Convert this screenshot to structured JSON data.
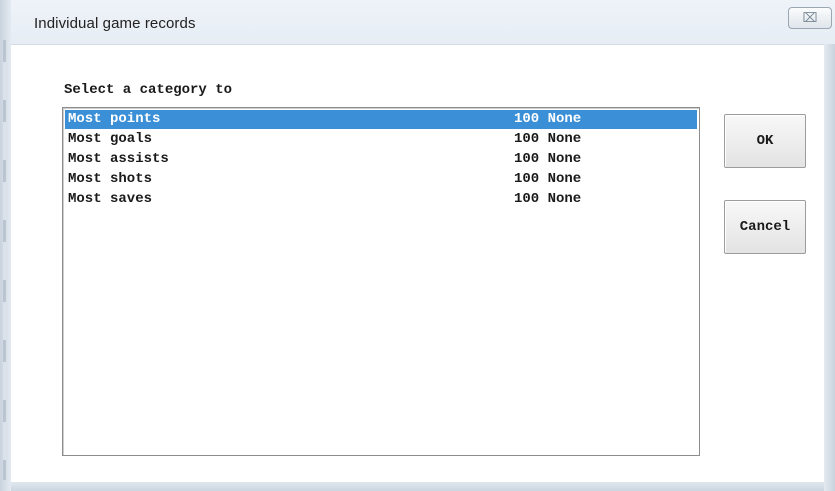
{
  "window": {
    "title": "Individual game records",
    "close_icon": "close-icon",
    "close_glyph": "⌧"
  },
  "dialog": {
    "prompt": "Select a category to",
    "list": {
      "selected_index": 0,
      "items": [
        {
          "name": "Most points",
          "value": "100 None"
        },
        {
          "name": "Most goals",
          "value": "100 None"
        },
        {
          "name": "Most assists",
          "value": "100 None"
        },
        {
          "name": "Most shots",
          "value": "100 None"
        },
        {
          "name": "Most saves",
          "value": "100 None"
        }
      ]
    },
    "buttons": {
      "ok_label": "OK",
      "cancel_label": "Cancel"
    }
  },
  "colors": {
    "selection_bg": "#3a8fd6",
    "selection_text": "#ffffff"
  }
}
